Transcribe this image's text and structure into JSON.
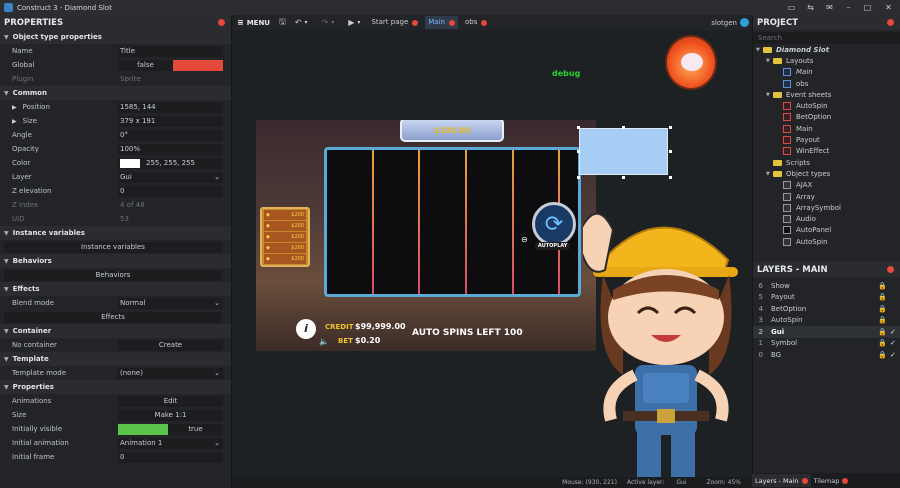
{
  "window": {
    "title": "Construct 3 - Diamond Slot"
  },
  "properties": {
    "header": "PROPERTIES",
    "sections": {
      "object_type": "Object type properties",
      "common": "Common",
      "instance_variables": "Instance variables",
      "behaviors": "Behaviors",
      "effects": "Effects",
      "container": "Container",
      "template": "Template",
      "props": "Properties"
    },
    "name_label": "Name",
    "name_value": "Title",
    "global_label": "Global",
    "global_value": "false",
    "plugin_label": "Plugin",
    "plugin_value": "Sprite",
    "position_label": "Position",
    "position_value": "1585, 144",
    "size_label": "Size",
    "size_value": "379 x 191",
    "angle_label": "Angle",
    "angle_value": "0°",
    "opacity_label": "Opacity",
    "opacity_value": "100%",
    "color_label": "Color",
    "color_value": "255, 255, 255",
    "layer_label": "Layer",
    "layer_value": "Gui",
    "zelev_label": "Z elevation",
    "zelev_value": "0",
    "zindex_label": "Z index",
    "zindex_value": "4 of 48",
    "uid_label": "UID",
    "uid_value": "53",
    "instance_vars_button": "Instance variables",
    "behaviors_button": "Behaviors",
    "blend_label": "Blend mode",
    "blend_value": "Normal",
    "effects_button": "Effects",
    "nocontainer_label": "No container",
    "create_button": "Create",
    "template_mode_label": "Template mode",
    "template_mode_value": "(none)",
    "animations_label": "Animations",
    "edit_button": "Edit",
    "size2_label": "Size",
    "make11_button": "Make 1:1",
    "initvis_label": "Initially visible",
    "initvis_value": "true",
    "initanim_label": "Initial animation",
    "initanim_value": "Animation 1",
    "initframe_label": "Initial frame",
    "initframe_value": "0"
  },
  "toolbar": {
    "menu": "MENU",
    "tabs": [
      "Start page",
      "Main",
      "obs"
    ],
    "user": "slotgen"
  },
  "canvas": {
    "debug": "debug",
    "win_banner": "$100.00",
    "credit_label": "CREDIT",
    "credit_value": "$99,999.00",
    "bet_label": "BET",
    "bet_value": "$0.20",
    "auto_spins": "AUTO SPINS LEFT 100",
    "autoplay": "AUTOPLAY",
    "paytable": [
      "$200",
      "$200",
      "$200",
      "$200",
      "$200"
    ]
  },
  "status": {
    "mouse": "Mouse: (930, 221)",
    "active_layer_label": "Active layer:",
    "active_layer": "Gui",
    "zoom": "Zoom: 45%"
  },
  "project": {
    "header": "PROJECT",
    "search_placeholder": "Search",
    "root": "Diamond Slot",
    "layouts_folder": "Layouts",
    "layouts": [
      "Main",
      "obs"
    ],
    "eventsheets_folder": "Event sheets",
    "eventsheets": [
      "AutoSpin",
      "BetOption",
      "Main",
      "Payout",
      "WinEffect"
    ],
    "scripts_folder": "Scripts",
    "objtypes_folder": "Object types",
    "objtypes": [
      "AJAX",
      "Array",
      "ArraySymbol",
      "Audio",
      "AutoPanel",
      "AutoSpin"
    ]
  },
  "layers": {
    "header": "LAYERS - MAIN",
    "rows": [
      {
        "num": "6",
        "name": "Show"
      },
      {
        "num": "5",
        "name": "Payout"
      },
      {
        "num": "4",
        "name": "BetOption"
      },
      {
        "num": "3",
        "name": "AutoSpin"
      },
      {
        "num": "2",
        "name": "Gui"
      },
      {
        "num": "1",
        "name": "Symbol"
      },
      {
        "num": "0",
        "name": "BG"
      }
    ]
  },
  "bottom_tabs": [
    "Layers - Main",
    "Tilemap"
  ],
  "colors": {
    "accent_red": "#e5493a",
    "selection": "#a8cdf4",
    "debug_green": "#27d22f"
  }
}
